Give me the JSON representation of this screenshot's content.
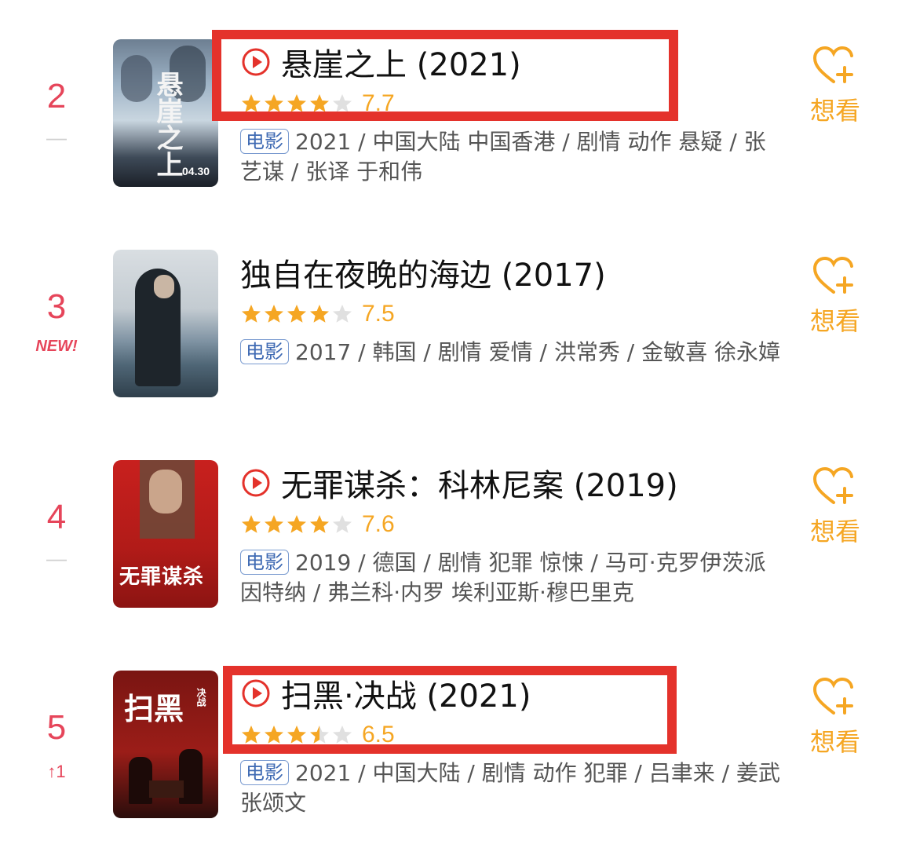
{
  "movies": [
    {
      "rank": "2",
      "rank_change": "—",
      "title": "悬崖之上 (2021)",
      "stars": 4,
      "score": "7.7",
      "badge": "电影",
      "meta": "2021 / 中国大陆 中国香港 / 剧情 动作 悬疑 / 张艺谋 / 张译 于和伟",
      "want_label": "想看",
      "poster_text": "悬崖之上",
      "poster_date": "04.30"
    },
    {
      "rank": "3",
      "rank_change": "NEW!",
      "title": "独自在夜晚的海边 (2017)",
      "stars": 4,
      "score": "7.5",
      "badge": "电影",
      "meta": "2017 / 韩国 / 剧情 爱情 / 洪常秀 / 金敏喜 徐永嫜",
      "want_label": "想看"
    },
    {
      "rank": "4",
      "rank_change": "—",
      "title": "无罪谋杀：科林尼案 (2019)",
      "stars": 4,
      "score": "7.6",
      "badge": "电影",
      "meta": "2019 / 德国 / 剧情 犯罪 惊悚 / 马可·克罗伊茨派因特纳 / 弗兰科·内罗 埃利亚斯·穆巴里克",
      "want_label": "想看",
      "poster_text": "无罪谋杀"
    },
    {
      "rank": "5",
      "rank_change": "↑1",
      "title": "扫黑·决战 (2021)",
      "stars": 3.5,
      "score": "6.5",
      "badge": "电影",
      "meta": "2021 / 中国大陆 / 剧情 动作 犯罪 / 吕聿来 / 姜武 张颂文",
      "want_label": "想看",
      "poster_text": "扫黑",
      "poster_sub": "决战"
    }
  ],
  "colors": {
    "rank": "#e6455a",
    "star": "#f5a623",
    "want": "#f5a623",
    "badge": "#3f6ab3",
    "highlight_box": "#e4322b"
  }
}
